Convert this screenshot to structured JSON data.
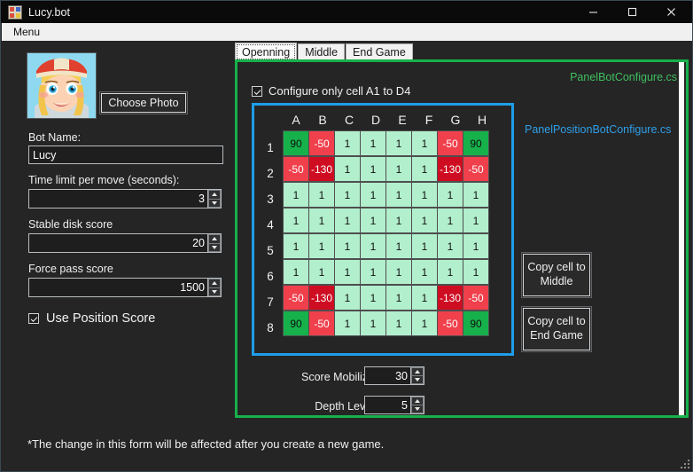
{
  "window": {
    "title": "Lucy.bot",
    "icon": "app-icon",
    "minimize_label": "–",
    "maximize_label": "□",
    "close_label": "✕"
  },
  "menubar": {
    "items": [
      {
        "label": "Menu"
      }
    ]
  },
  "left_panel": {
    "avatar_alt": "bot-avatar-photo",
    "choose_photo_label": "Choose Photo",
    "bot_name": {
      "label": "Bot Name:",
      "value": "Lucy"
    },
    "time_limit": {
      "label": "Time limit per move (seconds):",
      "value": "3"
    },
    "stable_disk": {
      "label": "Stable disk score",
      "value": "20"
    },
    "force_pass": {
      "label": "Force pass score",
      "value": "1500"
    },
    "use_position_score": {
      "label": "Use Position Score",
      "checked": true
    }
  },
  "tabs": [
    {
      "label": "Openning",
      "selected": true
    },
    {
      "label": "Middle",
      "selected": false
    },
    {
      "label": "End Game",
      "selected": false
    }
  ],
  "panel": {
    "panel_bot_configure_label": "PanelBotConfigure.cs",
    "panel_position_bot_configure_label": "PanelPositionBotConfigure.cs",
    "configure_only_checkbox": {
      "label": "Configure only cell A1 to D4",
      "checked": true
    },
    "copy_to_middle_label_line1": "Copy cell to",
    "copy_to_middle_label_line2": "Middle",
    "copy_to_endgame_label_line1": "Copy cell to",
    "copy_to_endgame_label_line2": "End Game",
    "score_mobilize": {
      "label": "Score Mobilize",
      "value": "30"
    },
    "depth_level": {
      "label": "Depth Level",
      "value": "5"
    }
  },
  "board": {
    "columns": [
      "A",
      "B",
      "C",
      "D",
      "E",
      "F",
      "G",
      "H"
    ],
    "rows": [
      "1",
      "2",
      "3",
      "4",
      "5",
      "6",
      "7",
      "8"
    ],
    "values": [
      [
        90,
        -50,
        1,
        1,
        1,
        1,
        -50,
        90
      ],
      [
        -50,
        -130,
        1,
        1,
        1,
        1,
        -130,
        -50
      ],
      [
        1,
        1,
        1,
        1,
        1,
        1,
        1,
        1
      ],
      [
        1,
        1,
        1,
        1,
        1,
        1,
        1,
        1
      ],
      [
        1,
        1,
        1,
        1,
        1,
        1,
        1,
        1
      ],
      [
        1,
        1,
        1,
        1,
        1,
        1,
        1,
        1
      ],
      [
        -50,
        -130,
        1,
        1,
        1,
        1,
        -130,
        -50
      ],
      [
        90,
        -50,
        1,
        1,
        1,
        1,
        -50,
        90
      ]
    ]
  },
  "footer": {
    "note": "*The change in this form will be affected after you create a new game."
  },
  "colors": {
    "green_border": "#16b14b",
    "blue_border": "#1e9ee8",
    "cell_neutral": "#b2efcd",
    "cell_high": "#16b14b",
    "cell_low": "#f0404c",
    "cell_lowest": "#cf0d22",
    "panel_label_green": "#3fbf5f",
    "panel_label_blue": "#2f9fe8"
  }
}
